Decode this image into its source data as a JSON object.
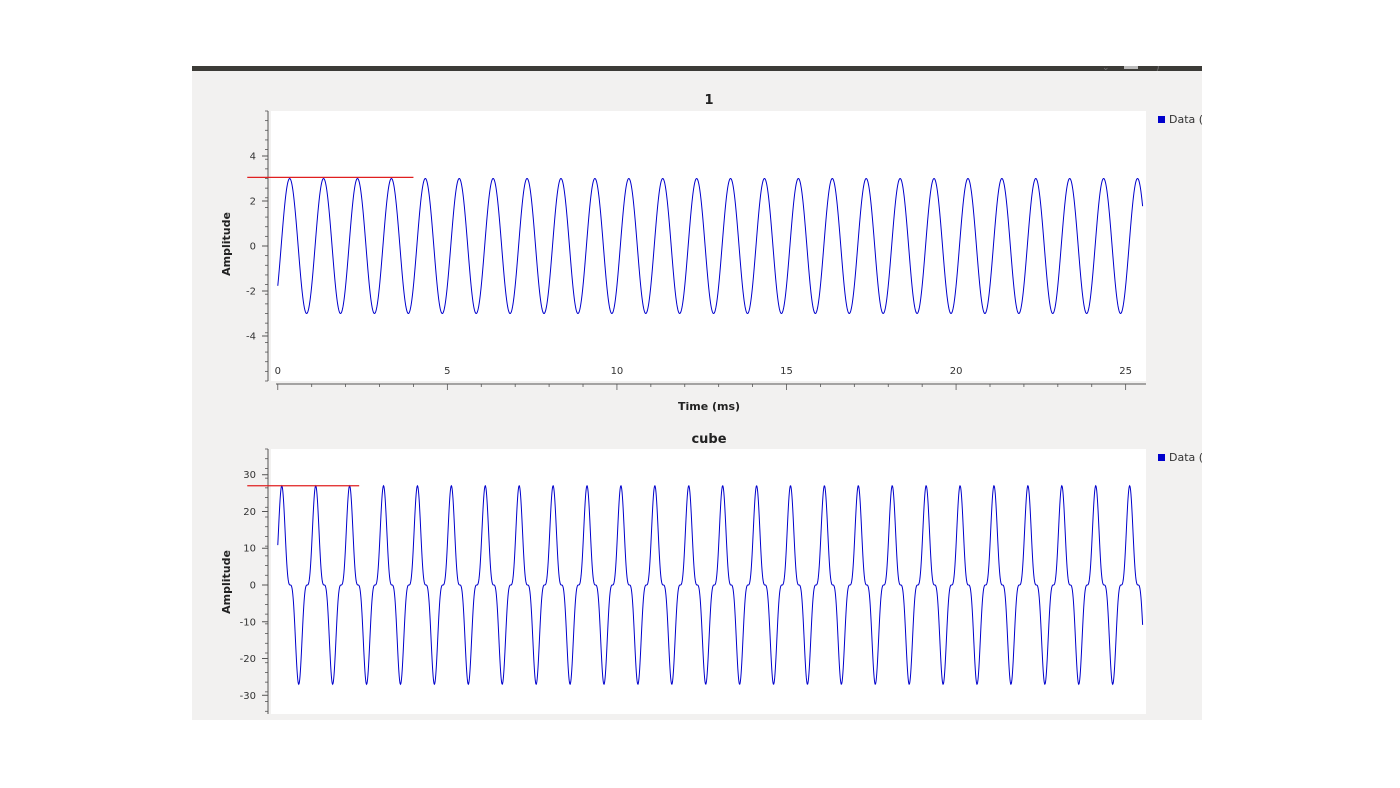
{
  "window": {
    "colors": {
      "window_bg": "#f2f1f0",
      "plot_bg": "#ffffff",
      "trace": "#0000cc",
      "marker": "#e02020",
      "titlebar": "#3c3b37"
    },
    "titlebar_icons": [
      "chevron-down-icon",
      "maximize-icon",
      "close-icon"
    ]
  },
  "chart_data": [
    {
      "type": "line",
      "title": "1",
      "xlabel": "Time (ms)",
      "ylabel": "Amplitude",
      "xlim": [
        -0.2,
        25.6
      ],
      "ylim": [
        -6,
        6
      ],
      "x_ticks": [
        0,
        5,
        10,
        15,
        20,
        25
      ],
      "y_ticks": [
        4,
        2,
        0,
        -2,
        -4
      ],
      "legend": {
        "label": "Data (",
        "position": "top-right, outside plot"
      },
      "marker_line": {
        "y": 3.05,
        "x_start": -0.9,
        "x_end": 4.0
      },
      "series": [
        {
          "name": "Data (",
          "waveform": "sine",
          "amplitude": 3,
          "period_ms": 1,
          "phase_start": -0.63,
          "x_start": 0,
          "x_end": 25.5
        }
      ]
    },
    {
      "type": "line",
      "title": "cube",
      "xlabel": "",
      "ylabel": "Amplitude",
      "xlim": [
        -0.2,
        25.6
      ],
      "ylim": [
        -37,
        37
      ],
      "x_ticks": [],
      "y_ticks": [
        30,
        20,
        10,
        0,
        -10,
        -20,
        -30
      ],
      "legend": {
        "label": "Data (",
        "position": "top-right, outside plot"
      },
      "marker_line": {
        "y": 27,
        "x_start": -0.9,
        "x_end": 2.4
      },
      "series": [
        {
          "name": "Data (",
          "waveform": "cubed sine",
          "amplitude": 27,
          "period_ms": 1,
          "phase_start": 0.83,
          "x_start": 0,
          "x_end": 25.5
        }
      ]
    }
  ]
}
